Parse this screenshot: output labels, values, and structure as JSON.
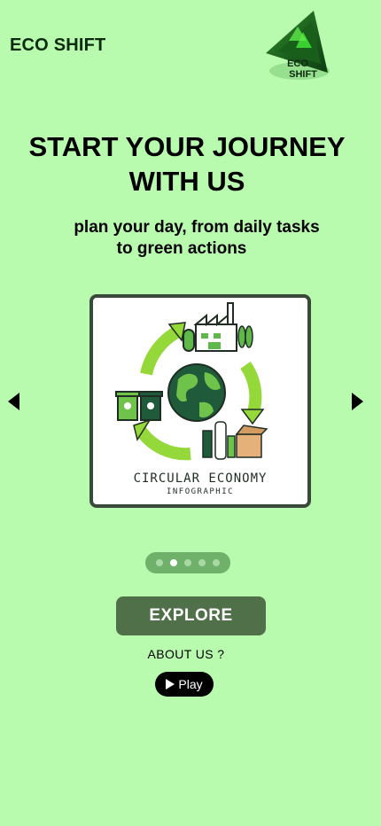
{
  "brand": {
    "name": "ECO SHIFT",
    "logo_line1": "ECO",
    "logo_line2": "SHIFT",
    "icon": "recycle-triangle-logo"
  },
  "hero": {
    "title_line1": "START YOUR JOURNEY",
    "title_line2": "WITH US",
    "subtitle_line1": "plan your day, from daily tasks",
    "subtitle_line2": "to green actions"
  },
  "carousel": {
    "slide": {
      "title": "CIRCULAR ECONOMY",
      "subtitle": "INFOGRAPHIC"
    },
    "prev_icon": "caret-left-icon",
    "next_icon": "caret-right-icon",
    "dots": [
      {
        "active": false
      },
      {
        "active": true
      },
      {
        "active": false
      },
      {
        "active": false
      },
      {
        "active": false
      }
    ]
  },
  "actions": {
    "explore_label": "EXPLORE",
    "about_label": "ABOUT US ?",
    "play_label": "Play"
  },
  "colors": {
    "background": "#b9fbae",
    "button": "#4f7048",
    "accent_green": "#5fb84a"
  }
}
